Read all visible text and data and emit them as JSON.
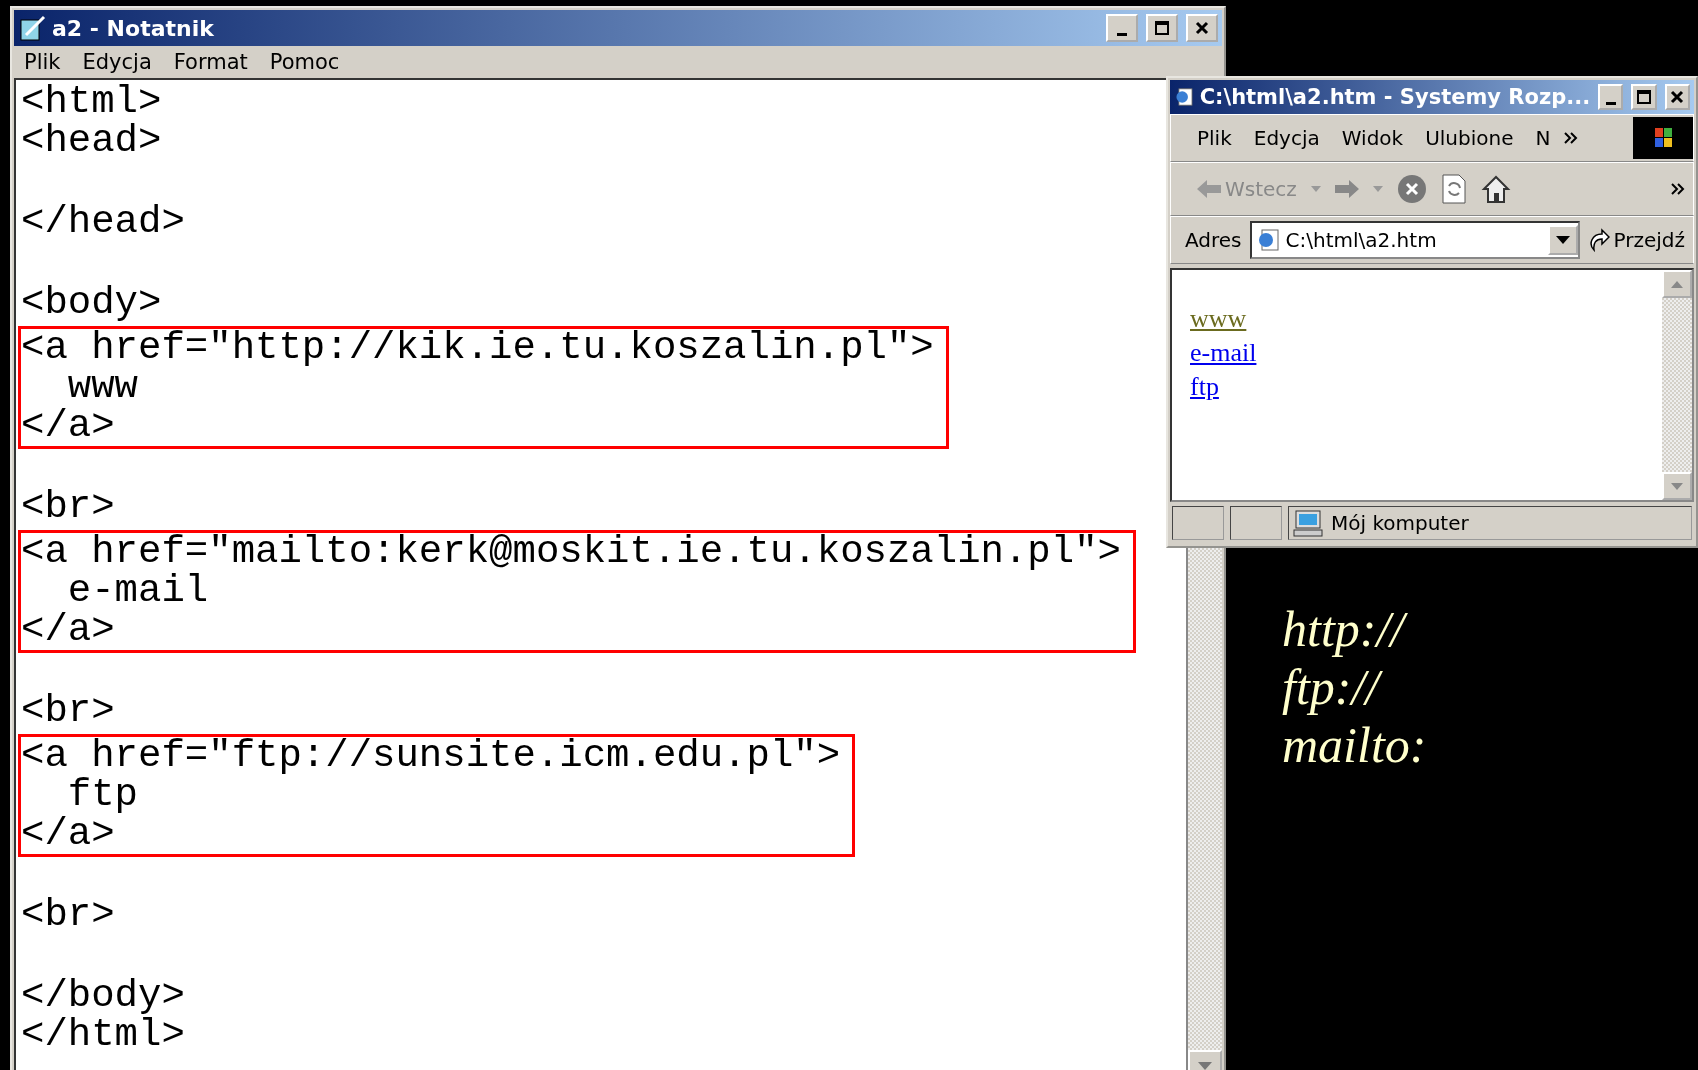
{
  "notepad": {
    "title": "a2 - Notatnik",
    "menu": [
      "Plik",
      "Edycja",
      "Format",
      "Pomoc"
    ],
    "paragraphs": [
      {
        "blocks": [
          {
            "highlighted": false,
            "lines": [
              "<html>",
              "<head>"
            ]
          }
        ]
      },
      {
        "blocks": [
          {
            "highlighted": false,
            "lines": [
              "</head>"
            ]
          }
        ]
      },
      {
        "blocks": [
          {
            "highlighted": false,
            "lines": [
              "<body>"
            ]
          },
          {
            "highlighted": true,
            "lines": [
              "<a href=\"http://kik.ie.tu.koszalin.pl\">",
              "  www",
              "</a>"
            ]
          }
        ]
      },
      {
        "blocks": [
          {
            "highlighted": false,
            "lines": [
              "<br>"
            ]
          },
          {
            "highlighted": true,
            "lines": [
              "<a href=\"mailto:kerk@moskit.ie.tu.koszalin.pl\">",
              "  e-mail",
              "</a>"
            ]
          }
        ]
      },
      {
        "blocks": [
          {
            "highlighted": false,
            "lines": [
              "<br>"
            ]
          },
          {
            "highlighted": true,
            "lines": [
              "<a href=\"ftp://sunsite.icm.edu.pl\">",
              "  ftp",
              "</a>"
            ]
          }
        ]
      },
      {
        "blocks": [
          {
            "highlighted": false,
            "lines": [
              "<br>"
            ]
          }
        ]
      },
      {
        "blocks": [
          {
            "highlighted": false,
            "lines": [
              "</body>",
              "</html>"
            ]
          }
        ]
      }
    ]
  },
  "browser": {
    "title": "C:\\html\\a2.htm - Systemy Rozp...",
    "menu": [
      "Plik",
      "Edycja",
      "Widok",
      "Ulubione",
      "N"
    ],
    "back_label": "Wstecz",
    "address_label": "Adres",
    "address": "C:\\html\\a2.htm",
    "go_label": "Przejdź",
    "links": [
      {
        "text": "www",
        "visited": true
      },
      {
        "text": "e-mail",
        "visited": false
      },
      {
        "text": "ftp",
        "visited": false
      }
    ],
    "status": "Mój komputer"
  },
  "slide_notes": [
    "http://",
    "ftp://",
    "mailto:"
  ]
}
